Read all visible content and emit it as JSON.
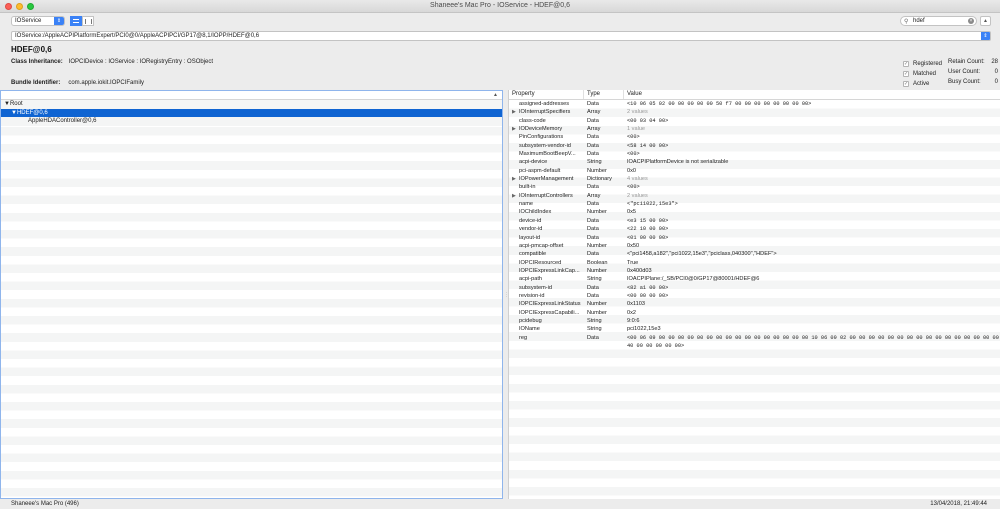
{
  "window": {
    "title": "Shaneee's Mac Pro - IOService - HDEF@0,6"
  },
  "toolbar": {
    "plane": "IOService",
    "search_value": "hdef"
  },
  "path": "IOService:/AppleACPIPlatformExpert/PCI0@0/AppleACPIPCI/GP17@8,1/IOPP/HDEF@0,6",
  "object": {
    "name": "HDEF@0,6",
    "inheritance_label": "Class Inheritance:",
    "inheritance": "IOPCIDevice : IOService : IORegistryEntry : OSObject",
    "bundle_label": "Bundle Identifier:",
    "bundle": "com.apple.iokit.IOPCIFamily"
  },
  "flags": [
    {
      "label": "Registered"
    },
    {
      "label": "Matched"
    },
    {
      "label": "Active"
    }
  ],
  "counts": [
    {
      "label": "Retain Count:",
      "value": "28"
    },
    {
      "label": "User Count:",
      "value": "0"
    },
    {
      "label": "Busy Count:",
      "value": "0"
    }
  ],
  "tree": [
    {
      "label": "▼Root",
      "selected": false
    },
    {
      "label": "▼HDEF@0,6",
      "selected": true
    },
    {
      "label": "AppleHDAController@0,6",
      "selected": false
    }
  ],
  "columns": {
    "property": "Property",
    "type": "Type",
    "value": "Value"
  },
  "properties": [
    {
      "p": "assigned-addresses",
      "t": "Data",
      "v": "<10 06 05 02 00 00 00 00 00 50 f7 00 00 00 00 00 00 00 00>",
      "mono": true
    },
    {
      "p": "IOInterruptSpecifiers",
      "t": "Array",
      "v": "2 values",
      "expand": true,
      "dim": true
    },
    {
      "p": "class-code",
      "t": "Data",
      "v": "<00 03 04 00>",
      "mono": true
    },
    {
      "p": "IODeviceMemory",
      "t": "Array",
      "v": "1 value",
      "expand": true,
      "dim": true
    },
    {
      "p": "PinConfigurations",
      "t": "Data",
      "v": "<00>",
      "mono": true
    },
    {
      "p": "subsystem-vendor-id",
      "t": "Data",
      "v": "<58 14 00 00>",
      "mono": true
    },
    {
      "p": "MaximumBootBeepV...",
      "t": "Data",
      "v": "<00>",
      "mono": true
    },
    {
      "p": "acpi-device",
      "t": "String",
      "v": "IOACPIPlatformDevice is not serializable"
    },
    {
      "p": "pci-aspm-default",
      "t": "Number",
      "v": "0x0"
    },
    {
      "p": "IOPowerManagement",
      "t": "Dictionary",
      "v": "4 values",
      "expand": true,
      "dim": true
    },
    {
      "p": "built-in",
      "t": "Data",
      "v": "<00>",
      "mono": true
    },
    {
      "p": "IOInterruptControllers",
      "t": "Array",
      "v": "2 values",
      "expand": true,
      "dim": true
    },
    {
      "p": "name",
      "t": "Data",
      "v": "<\"pci1022,15e3\">",
      "mono": true
    },
    {
      "p": "IOChildIndex",
      "t": "Number",
      "v": "0x5"
    },
    {
      "p": "device-id",
      "t": "Data",
      "v": "<e3 15 00 00>",
      "mono": true
    },
    {
      "p": "vendor-id",
      "t": "Data",
      "v": "<22 10 00 00>",
      "mono": true
    },
    {
      "p": "layout-id",
      "t": "Data",
      "v": "<01 00 00 00>",
      "mono": true
    },
    {
      "p": "acpi-pmcap-offset",
      "t": "Number",
      "v": "0x50"
    },
    {
      "p": "compatible",
      "t": "Data",
      "v": "<\"pci1458,a182\",\"pci1022,15e3\",\"pciclass,040300\",\"HDEF\">"
    },
    {
      "p": "IOPCIResourced",
      "t": "Boolean",
      "v": "True"
    },
    {
      "p": "IOPCIExpressLinkCap...",
      "t": "Number",
      "v": "0x400d03"
    },
    {
      "p": "acpi-path",
      "t": "String",
      "v": "IOACPIPlane:/_SB/PCI0@0/GP17@80001/HDEF@6"
    },
    {
      "p": "subsystem-id",
      "t": "Data",
      "v": "<82 a1 00 00>",
      "mono": true
    },
    {
      "p": "revision-id",
      "t": "Data",
      "v": "<00 00 00 00>",
      "mono": true
    },
    {
      "p": "IOPCIExpressLinkStatus",
      "t": "Number",
      "v": "0x1103"
    },
    {
      "p": "IOPCIExpressCapabili...",
      "t": "Number",
      "v": "0x2"
    },
    {
      "p": "pcidebug",
      "t": "String",
      "v": "9:0:6"
    },
    {
      "p": "IOName",
      "t": "String",
      "v": "pci1022,15e3"
    },
    {
      "p": "reg",
      "t": "Data",
      "v": "<00 06 09 00 00 00 00 00 00 00 00 00 00 00 00 00 00 00 00 10 06 09 02 00 00 00 00 00 00 00 00 00 00 00 00 00 00 00 00 40 00 00 00 00 00>",
      "mono": true,
      "tall": true
    }
  ],
  "status": {
    "left": "Shaneee's Mac Pro (496)",
    "right": "13/04/2018, 21:49:44"
  }
}
